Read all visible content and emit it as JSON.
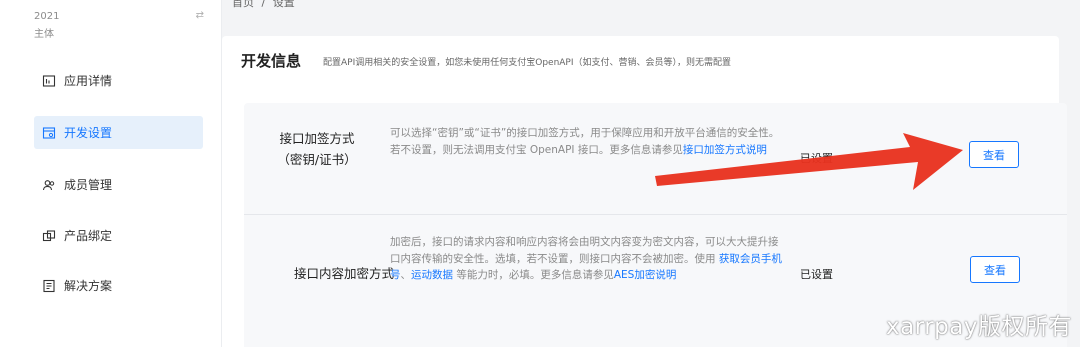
{
  "sidebar": {
    "app_meta_line1": "2021",
    "app_meta_line2": "主体",
    "items": [
      {
        "label": "应用详情",
        "icon": "app-details-icon",
        "active": false
      },
      {
        "label": "开发设置",
        "icon": "dev-settings-icon",
        "active": true
      },
      {
        "label": "成员管理",
        "icon": "members-icon",
        "active": false
      },
      {
        "label": "产品绑定",
        "icon": "product-bind-icon",
        "active": false
      },
      {
        "label": "解决方案",
        "icon": "solutions-icon",
        "active": false
      }
    ]
  },
  "breadcrumb": {
    "home": "首页",
    "separator": "/",
    "current": "设置"
  },
  "section": {
    "title": "开发信息",
    "description": "配置API调用相关的安全设置，如您未使用任何支付宝OpenAPI（如支付、营销、会员等），则无需配置"
  },
  "rows": [
    {
      "name_line1": "接口加签方式",
      "name_line2": "（密钥/证书）",
      "desc_text": "可以选择“密钥”或“证书”的接口加签方式，用于保障应用和开放平台通信的安全性。若不设置，则无法调用支付宝 OpenAPI 接口。更多信息请参见",
      "desc_link": "接口加签方式说明",
      "status": "已设置",
      "button": "查看"
    },
    {
      "name": "接口内容加密方式",
      "desc_part1": "加密后，接口的请求内容和响应内容将会由明文内容变为密文内容，可以大大提升接口内容传输的安全性。选填，若不设置，则接口内容不会被加密。使用 ",
      "desc_link1": "获取会员手机号",
      "desc_part2": "、",
      "desc_link2": "运动数据",
      "desc_part3": " 等能力时，必填。更多信息请参见",
      "desc_link3": "AES加密说明",
      "status": "已设置",
      "button": "查看"
    }
  ],
  "colors": {
    "accent": "#1677ff",
    "arrow": "#e8321f",
    "active_bg": "#e6f0fb"
  },
  "watermark": "xarrpay版权所有"
}
